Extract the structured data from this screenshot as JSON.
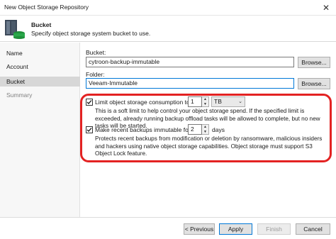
{
  "window": {
    "title": "New Object Storage Repository"
  },
  "header": {
    "title": "Bucket",
    "subtitle": "Specify object storage system bucket to use."
  },
  "sidebar": {
    "items": [
      {
        "label": "Name"
      },
      {
        "label": "Account"
      },
      {
        "label": "Bucket"
      },
      {
        "label": "Summary"
      }
    ]
  },
  "form": {
    "bucket_label": "Bucket:",
    "bucket_value": "cytroon-backup-immutable",
    "browse_label": "Browse...",
    "folder_label": "Folder:",
    "folder_value": "Veeam-Immutable",
    "limit": {
      "label": "Limit object storage consumption to:",
      "value": "1",
      "unit": "TB",
      "note": "This is a soft limit to help control your object storage spend. If the specified limit is exceeded, already running backup offload tasks will be allowed to complete, but no new tasks will be started."
    },
    "immutable": {
      "label": "Make recent backups immutable for:",
      "value": "2",
      "unit": "days",
      "note": "Protects recent backups from modification or deletion by ransomware, malicious insiders and hackers using native object storage capabilities. Object storage must support S3 Object Lock feature."
    }
  },
  "footer": {
    "previous": "< Previous",
    "apply": "Apply",
    "finish": "Finish",
    "cancel": "Cancel"
  },
  "colors": {
    "highlight": "#e32222",
    "focus": "#0078d7"
  }
}
